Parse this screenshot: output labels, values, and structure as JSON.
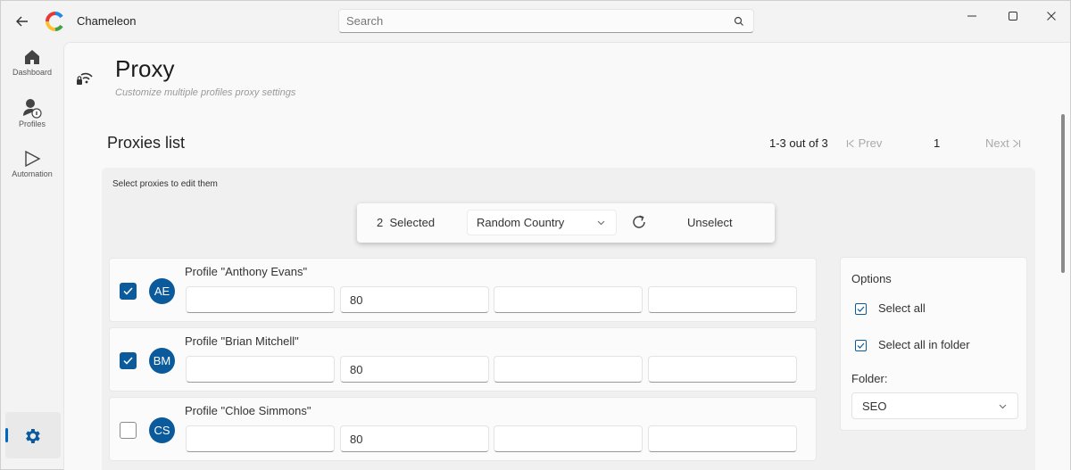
{
  "app": {
    "title": "Chameleon"
  },
  "search": {
    "placeholder": "Search"
  },
  "sidebar": {
    "items": [
      {
        "label": "Dashboard",
        "icon": "home-icon"
      },
      {
        "label": "Profiles",
        "icon": "profiles-icon"
      },
      {
        "label": "Automation",
        "icon": "play-icon"
      }
    ],
    "settings_icon": "gear-icon"
  },
  "page": {
    "title": "Proxy",
    "subtitle": "Customize multiple profiles proxy settings"
  },
  "list": {
    "title": "Proxies list",
    "hint": "Select proxies to edit them",
    "pagination": {
      "info": "1-3 out of 3",
      "prev": "Prev",
      "page": "1",
      "next": "Next"
    }
  },
  "toolbar": {
    "selected_label": "2  Selected",
    "country": "Random Country",
    "unselect": "Unselect"
  },
  "profiles": [
    {
      "label": "Profile \"Anthony Evans\"",
      "initials": "AE",
      "checked": true,
      "fields": [
        "",
        "80",
        "",
        ""
      ]
    },
    {
      "label": "Profile \"Brian Mitchell\"",
      "initials": "BM",
      "checked": true,
      "fields": [
        "",
        "80",
        "",
        ""
      ]
    },
    {
      "label": "Profile \"Chloe Simmons\"",
      "initials": "CS",
      "checked": false,
      "fields": [
        "",
        "80",
        "",
        ""
      ]
    }
  ],
  "options": {
    "title": "Options",
    "select_all": "Select all",
    "select_all_folder": "Select all in folder",
    "folder_label": "Folder:",
    "folder_value": "SEO"
  },
  "colors": {
    "accent": "#0a5a9c",
    "indicator": "#0067c0"
  }
}
